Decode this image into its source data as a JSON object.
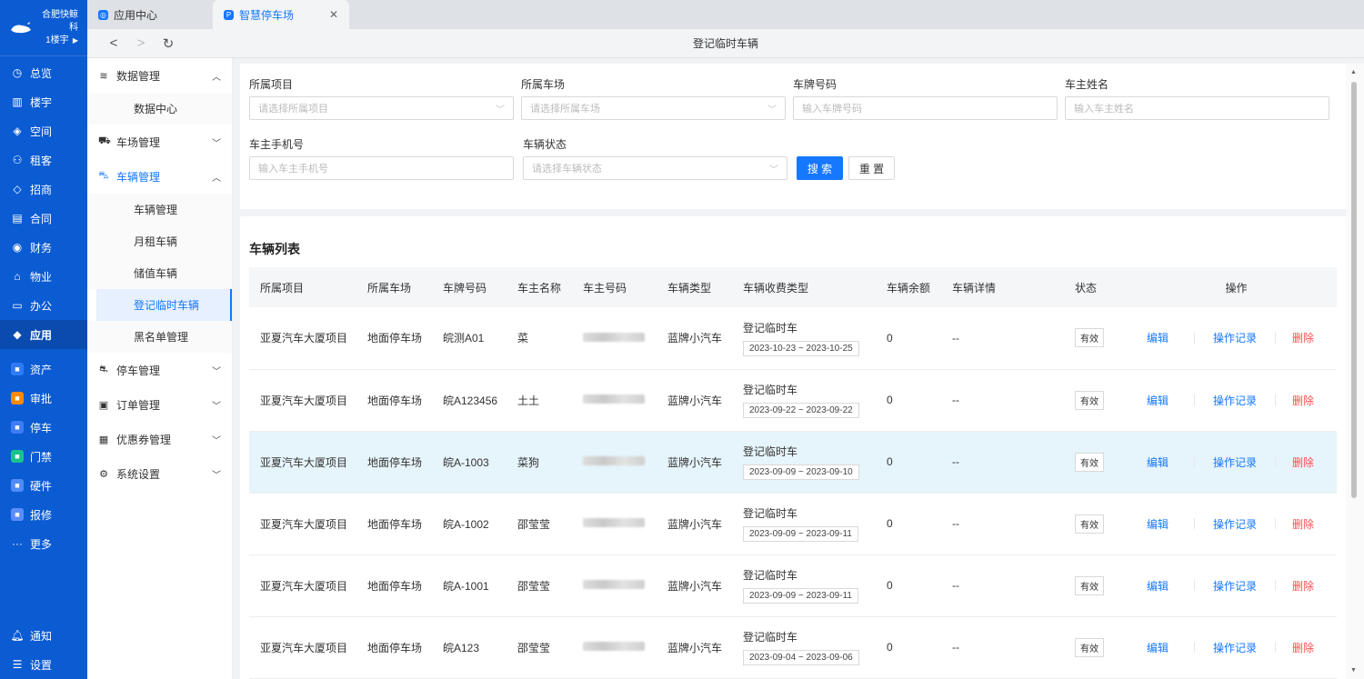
{
  "brand": {
    "name": "合肥快鲸科",
    "building": "1楼宇"
  },
  "rail": {
    "items": [
      {
        "icon": "dashboard-icon",
        "label": "总览"
      },
      {
        "icon": "building-icon",
        "label": "楼宇"
      },
      {
        "icon": "cube-icon",
        "label": "空间"
      },
      {
        "icon": "tenant-icon",
        "label": "租客"
      },
      {
        "icon": "tag-icon",
        "label": "招商"
      },
      {
        "icon": "contract-icon",
        "label": "合同"
      },
      {
        "icon": "finance-icon",
        "label": "财务"
      },
      {
        "icon": "property-icon",
        "label": "物业"
      },
      {
        "icon": "office-icon",
        "label": "办公"
      },
      {
        "icon": "app-icon",
        "label": "应用"
      }
    ],
    "apps": [
      {
        "icon": "asset-icon",
        "label": "资产",
        "color": "#2f7bf5"
      },
      {
        "icon": "approval-icon",
        "label": "审批",
        "color": "#ff8a00"
      },
      {
        "icon": "parking-icon",
        "label": "停车",
        "color": "#3d7df6"
      },
      {
        "icon": "gate-icon",
        "label": "门禁",
        "color": "#18c38c"
      },
      {
        "icon": "hardware-icon",
        "label": "硬件",
        "color": "#4e8cf7"
      },
      {
        "icon": "repair-icon",
        "label": "报修",
        "color": "#5a8df8"
      }
    ],
    "more": "更多",
    "notify": "通知",
    "settings": "设置"
  },
  "tabs": [
    {
      "label": "应用中心"
    },
    {
      "label": "智慧停车场"
    }
  ],
  "page_title": "登记临时车辆",
  "sidebar": {
    "groups": [
      {
        "label": "数据管理",
        "icon": "layers-icon",
        "expanded": true,
        "children": [
          "数据中心"
        ]
      },
      {
        "label": "车场管理",
        "icon": "road-icon",
        "expanded": false,
        "children": []
      },
      {
        "label": "车辆管理",
        "icon": "car-icon",
        "expanded": true,
        "children": [
          "车辆管理",
          "月租车辆",
          "储值车辆",
          "登记临时车辆",
          "黑名单管理"
        ]
      },
      {
        "label": "停车管理",
        "icon": "park-icon",
        "expanded": false,
        "children": []
      },
      {
        "label": "订单管理",
        "icon": "order-icon",
        "expanded": false,
        "children": []
      },
      {
        "label": "优惠券管理",
        "icon": "coupon-icon",
        "expanded": false,
        "children": []
      },
      {
        "label": "系统设置",
        "icon": "gear-icon",
        "expanded": false,
        "children": []
      }
    ]
  },
  "filter": {
    "project": {
      "label": "所属项目",
      "placeholder": "请选择所属项目"
    },
    "lot": {
      "label": "所属车场",
      "placeholder": "请选择所属车场"
    },
    "plate": {
      "label": "车牌号码",
      "placeholder": "输入车牌号码"
    },
    "owner": {
      "label": "车主姓名",
      "placeholder": "输入车主姓名"
    },
    "phone": {
      "label": "车主手机号",
      "placeholder": "输入车主手机号"
    },
    "status": {
      "label": "车辆状态",
      "placeholder": "请选择车辆状态"
    },
    "search_btn": "搜 索",
    "reset_btn": "重 置"
  },
  "list": {
    "title": "车辆列表",
    "columns": [
      "所属项目",
      "所属车场",
      "车牌号码",
      "车主名称",
      "车主号码",
      "车辆类型",
      "车辆收费类型",
      "车辆余额",
      "车辆详情",
      "状态",
      "操作"
    ],
    "rows": [
      {
        "project": "亚夏汽车大厦项目",
        "lot": "地面停车场",
        "plate": "皖测A01",
        "owner": "菜",
        "type": "蓝牌小汽车",
        "fee": "登记临时车",
        "range": "2023-10-23 ~ 2023-10-25",
        "balance": "0",
        "detail": "--",
        "status": "有效"
      },
      {
        "project": "亚夏汽车大厦项目",
        "lot": "地面停车场",
        "plate": "皖A123456",
        "owner": "土土",
        "type": "蓝牌小汽车",
        "fee": "登记临时车",
        "range": "2023-09-22 ~ 2023-09-22",
        "balance": "0",
        "detail": "--",
        "status": "有效"
      },
      {
        "project": "亚夏汽车大厦项目",
        "lot": "地面停车场",
        "plate": "皖A-1003",
        "owner": "菜狗",
        "type": "蓝牌小汽车",
        "fee": "登记临时车",
        "range": "2023-09-09 ~ 2023-09-10",
        "balance": "0",
        "detail": "--",
        "status": "有效"
      },
      {
        "project": "亚夏汽车大厦项目",
        "lot": "地面停车场",
        "plate": "皖A-1002",
        "owner": "邵莹莹",
        "type": "蓝牌小汽车",
        "fee": "登记临时车",
        "range": "2023-09-09 ~ 2023-09-11",
        "balance": "0",
        "detail": "--",
        "status": "有效"
      },
      {
        "project": "亚夏汽车大厦项目",
        "lot": "地面停车场",
        "plate": "皖A-1001",
        "owner": "邵莹莹",
        "type": "蓝牌小汽车",
        "fee": "登记临时车",
        "range": "2023-09-09 ~ 2023-09-11",
        "balance": "0",
        "detail": "--",
        "status": "有效"
      },
      {
        "project": "亚夏汽车大厦项目",
        "lot": "地面停车场",
        "plate": "皖A123",
        "owner": "邵莹莹",
        "type": "蓝牌小汽车",
        "fee": "登记临时车",
        "range": "2023-09-04 ~ 2023-09-06",
        "balance": "0",
        "detail": "--",
        "status": "有效"
      }
    ],
    "actions": {
      "edit": "编辑",
      "log": "操作记录",
      "delete": "删除"
    }
  },
  "colors": {
    "primary": "#1677ff",
    "rail": "#0b5bd3",
    "danger": "#ff4d4f",
    "highlight_row": "#e6f4fb"
  }
}
